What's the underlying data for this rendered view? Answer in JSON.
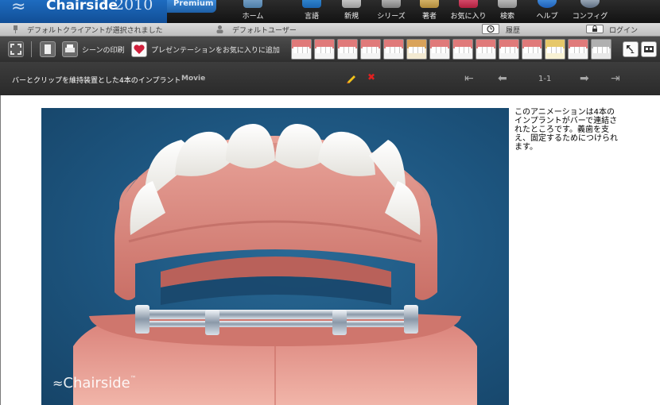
{
  "app": {
    "brand": "Chairside",
    "trademark": "®",
    "year": "2010",
    "edition": "Premium"
  },
  "nav": [
    {
      "id": "home",
      "label": "ホーム",
      "icon": "home-icon"
    },
    {
      "id": "language",
      "label": "言語",
      "icon": "language-icon"
    },
    {
      "id": "new",
      "label": "新規",
      "icon": "new-icon"
    },
    {
      "id": "series",
      "label": "シリーズ",
      "icon": "series-icon"
    },
    {
      "id": "author",
      "label": "著者",
      "icon": "author-icon"
    },
    {
      "id": "favorites",
      "label": "お気に入り",
      "icon": "heart-icon"
    },
    {
      "id": "search",
      "label": "検索",
      "icon": "search-icon"
    },
    {
      "id": "help",
      "label": "ヘルプ",
      "icon": "help-icon"
    },
    {
      "id": "config",
      "label": "コンフィグ",
      "icon": "gear-icon"
    }
  ],
  "status": {
    "client": "デフォルトクライアントが選択されました",
    "user": "デフォルトユーザー",
    "history": "履歴",
    "login": "ログイン"
  },
  "toolbar": {
    "print": "シーンの印刷",
    "add_favorite": "プレゼンテーションをお気に入りに追加"
  },
  "scene": {
    "title": "バーとクリップを維持装置とした4本のインプラント",
    "type": "Movie",
    "counter": "1-1"
  },
  "video": {
    "watermark": "Chairside",
    "watermark_tm": "™"
  },
  "description": "このアニメーションは4本のインプラントがバーで連結されたところです。義歯を支え、固定するためにつけられます。"
}
